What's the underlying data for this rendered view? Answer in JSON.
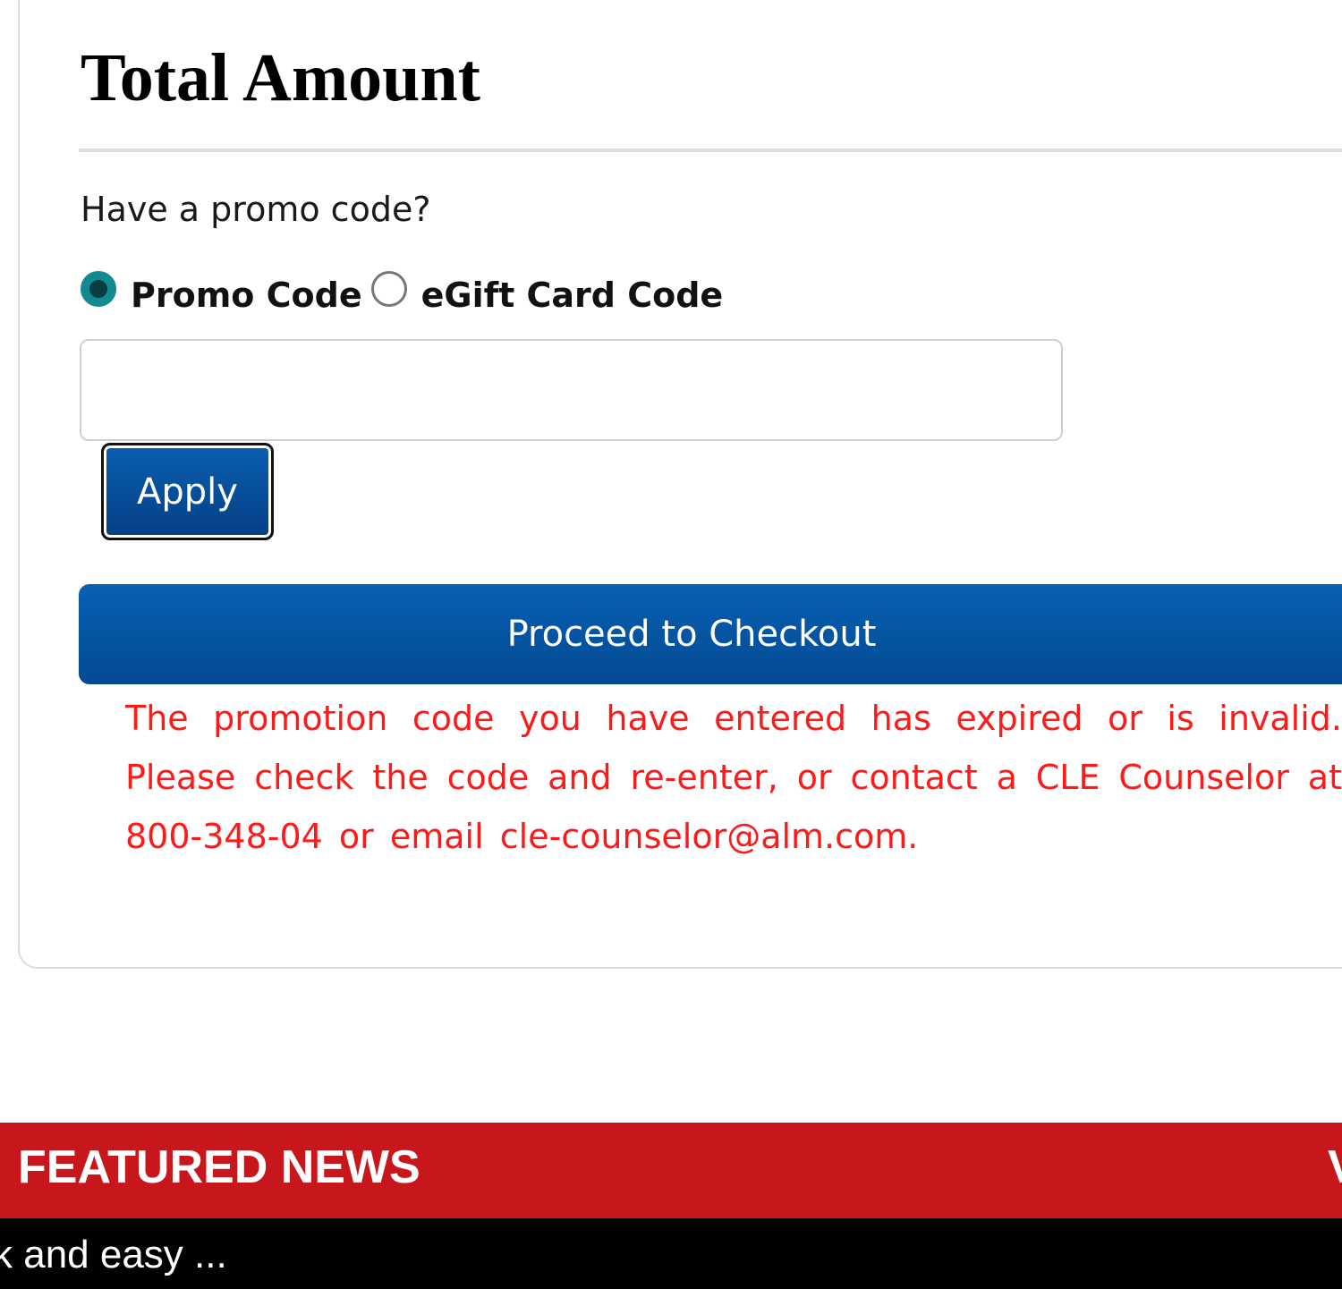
{
  "summary": {
    "title": "Total Amount",
    "promo_question": "Have a promo code?",
    "code_type_options": [
      {
        "label": "Promo Code",
        "selected": true
      },
      {
        "label": "eGift Card Code",
        "selected": false
      }
    ],
    "code_input": {
      "value": "",
      "placeholder": ""
    },
    "apply_label": "Apply",
    "checkout_label": "Proceed to Checkout",
    "error_message": "The promotion code you have entered has expired or is invalid. Please check the code and re-enter, or contact a CLE Counselor at 800-348-04 or email cle-counselor@alm.com."
  },
  "featured_news": {
    "title": "FEATURED NEWS",
    "right_label": "V",
    "ticker_text": "k and easy ..."
  },
  "colors": {
    "radio_selected": "#128a92",
    "button_blue": "#0a5fb0",
    "error_red": "#ff1a1a",
    "featured_red": "#c8161d",
    "ticker_black": "#000000"
  }
}
